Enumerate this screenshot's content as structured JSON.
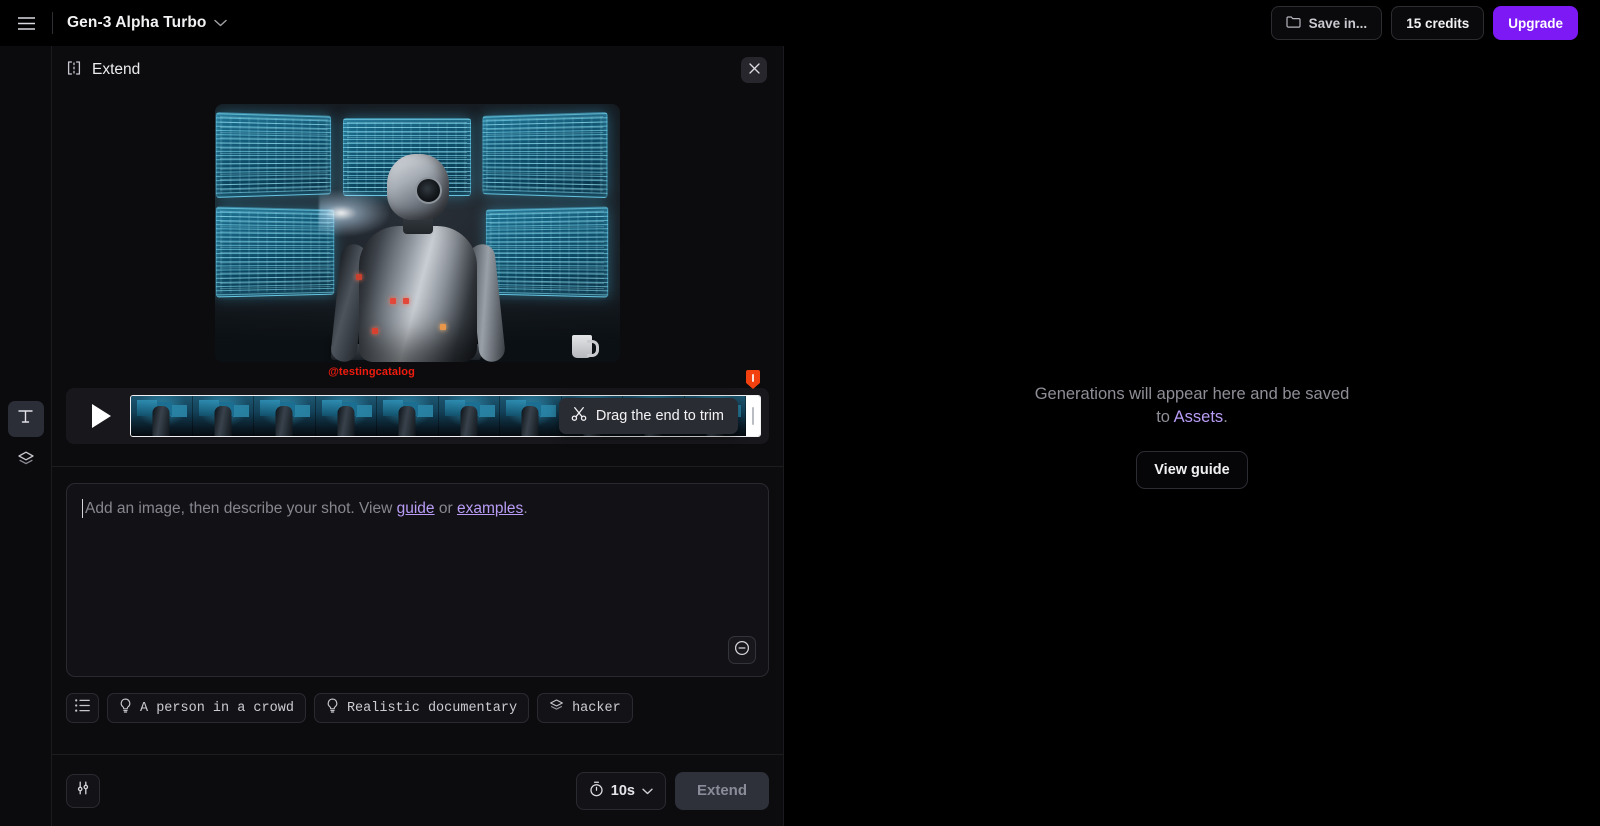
{
  "topbar": {
    "menu_icon": "hamburger-icon",
    "model_name": "Gen-3 Alpha Turbo",
    "model_chevron": "chevron-down-icon",
    "save_in_label": "Save in...",
    "save_in_icon": "folder-icon",
    "credits_label": "15 credits",
    "upgrade_label": "Upgrade",
    "upgrade_color": "#7c19f5"
  },
  "rail": {
    "items": [
      {
        "name": "text-tool",
        "glyph": "T",
        "active": true
      },
      {
        "name": "layers-tool",
        "glyph": "layers-icon",
        "active": false
      }
    ]
  },
  "panel": {
    "title": "Extend",
    "title_icon": "extend-brackets-icon",
    "close_icon": "close-icon"
  },
  "preview": {
    "alt": "robot seen from behind facing glowing cyan code monitors"
  },
  "timeline": {
    "play_icon": "play-icon",
    "watermark": "@testingcatalog",
    "watermark_color": "#f01b0d",
    "tooltip_text": "Drag the end to trim",
    "tooltip_icon": "scissors-icon",
    "trim_handle": "trim-handle-right",
    "marker": "playhead-marker"
  },
  "prompt": {
    "placeholder_prefix": "Add an image, then describe your shot. View ",
    "link_guide": "guide",
    "placeholder_or": " or ",
    "link_examples": "examples",
    "placeholder_suffix": ".",
    "value": "",
    "collapse_icon": "minus-circle-icon"
  },
  "chips": [
    {
      "name": "chip-list",
      "icon": "list-icon",
      "label": ""
    },
    {
      "name": "chip-a-person-in-a-crowd",
      "icon": "lightbulb-icon",
      "label": "A person in a crowd"
    },
    {
      "name": "chip-realistic-documentary",
      "icon": "lightbulb-icon",
      "label": "Realistic documentary"
    },
    {
      "name": "chip-hacker",
      "icon": "layers-icon",
      "label": "hacker"
    }
  ],
  "footer": {
    "settings_icon": "sliders-icon",
    "duration_icon": "stopwatch-icon",
    "duration_label": "10s",
    "duration_chevron": "chevron-down-icon",
    "extend_label": "Extend",
    "extend_disabled": true
  },
  "right_pane": {
    "empty_prefix": "Generations will appear here and be saved to ",
    "empty_link": "Assets",
    "empty_suffix": ".",
    "view_guide_label": "View guide"
  }
}
